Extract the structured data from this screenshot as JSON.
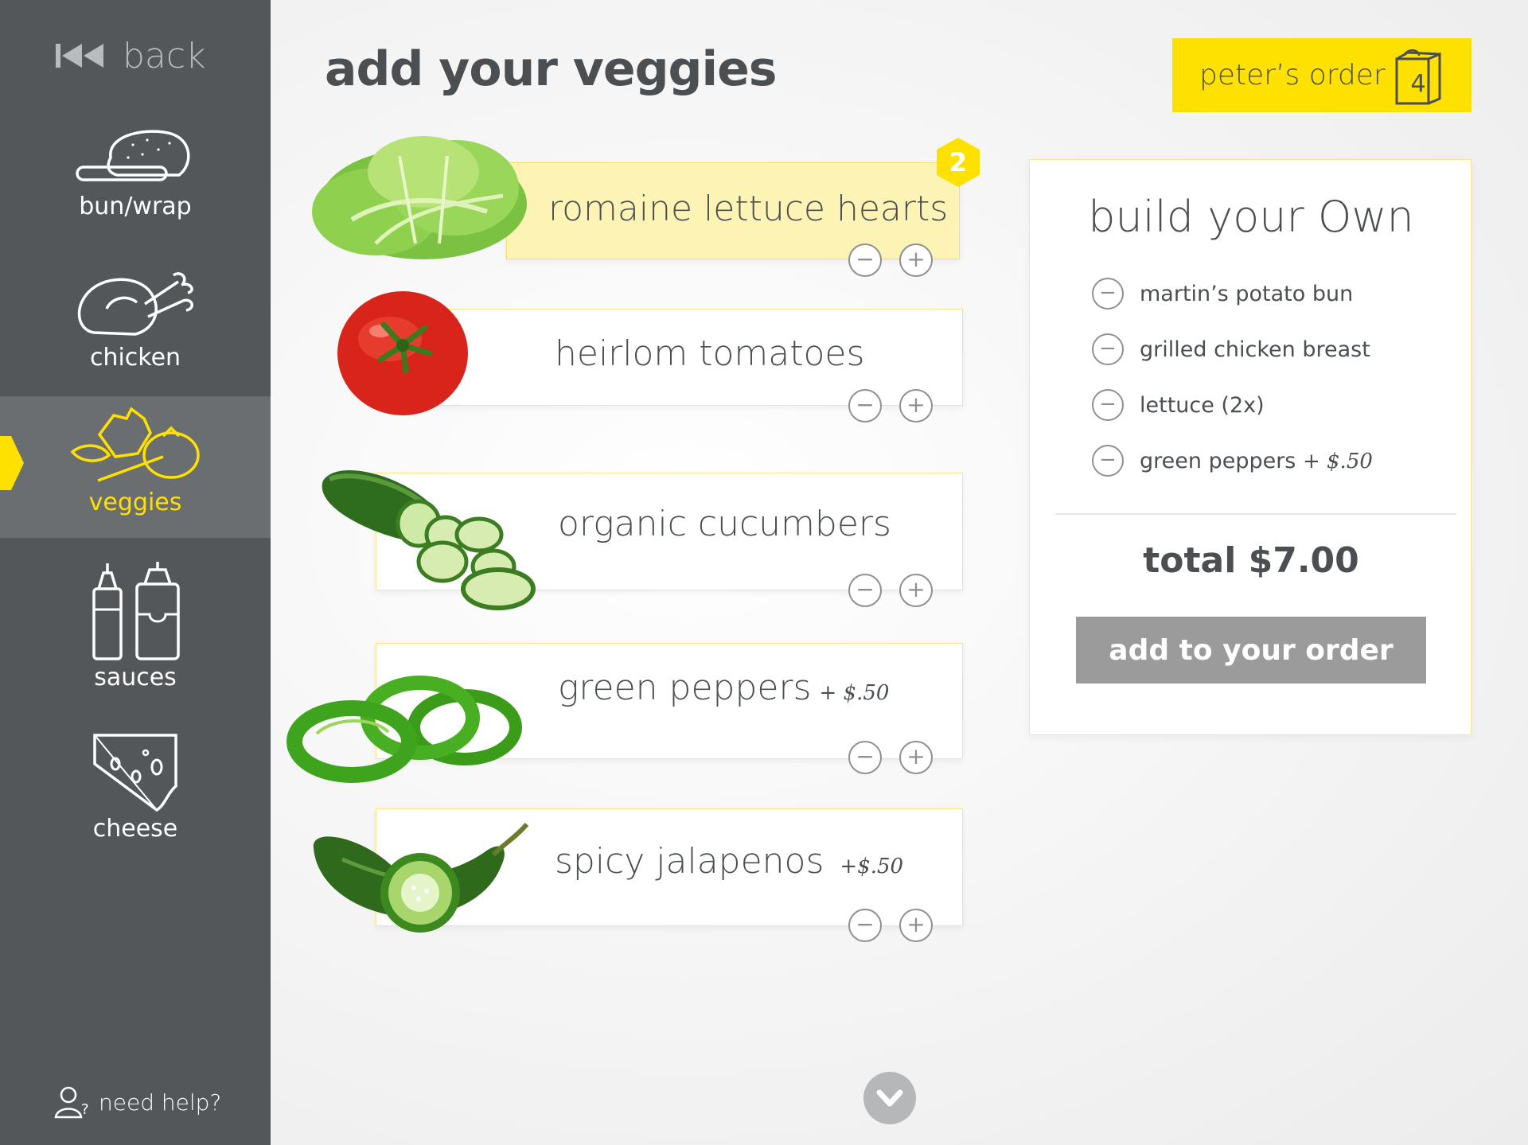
{
  "sidebar": {
    "back_label": "back",
    "items": [
      {
        "label": "bun/wrap",
        "icon": "bun-icon"
      },
      {
        "label": "chicken",
        "icon": "chicken-icon"
      },
      {
        "label": "veggies",
        "icon": "veggies-icon",
        "active": true
      },
      {
        "label": "sauces",
        "icon": "sauces-icon"
      },
      {
        "label": "cheese",
        "icon": "cheese-icon"
      }
    ],
    "help_label": "need help?"
  },
  "header": {
    "title": "add your veggies",
    "order_label": "peter’s order",
    "order_count": "4"
  },
  "veggies": [
    {
      "name": "romaine lettuce hearts",
      "price": "",
      "selected": true,
      "quantity": "2",
      "image": "lettuce-image"
    },
    {
      "name": "heirlom tomatoes",
      "price": "",
      "selected": false,
      "image": "tomato-image"
    },
    {
      "name": "organic cucumbers",
      "price": "",
      "selected": false,
      "image": "cucumber-image"
    },
    {
      "name": "green peppers",
      "price": "+ $.50",
      "selected": false,
      "image": "green-pepper-image"
    },
    {
      "name": "spicy jalapenos",
      "price": "+$.50",
      "selected": false,
      "image": "jalapeno-image"
    }
  ],
  "controls": {
    "minus": "−",
    "plus": "+"
  },
  "summary": {
    "title": "build your Own",
    "items": [
      {
        "text": "martin’s potato bun",
        "price": ""
      },
      {
        "text": "grilled chicken breast",
        "price": ""
      },
      {
        "text": "lettuce (2x)",
        "price": ""
      },
      {
        "text": "green peppers",
        "price": "+ $.50"
      }
    ],
    "total": "total $7.00",
    "add_label": "add to your order"
  },
  "colors": {
    "sidebar": "#53575a",
    "accent_yellow": "#ffe100",
    "selected_card": "#fcf3b5",
    "button_gray": "#9b9b9b"
  }
}
